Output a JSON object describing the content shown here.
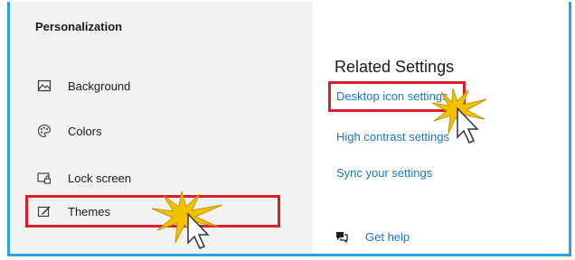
{
  "sidebar": {
    "title": "Personalization",
    "items": [
      {
        "label": "Background",
        "icon": "image-icon"
      },
      {
        "label": "Colors",
        "icon": "palette-icon"
      },
      {
        "label": "Lock screen",
        "icon": "lock-screen-icon"
      },
      {
        "label": "Themes",
        "icon": "themes-icon",
        "selected": true
      }
    ]
  },
  "main": {
    "section_title": "Related Settings",
    "links": [
      "Desktop icon settings",
      "High contrast settings",
      "Sync your settings"
    ],
    "help_label": "Get help"
  },
  "colors": {
    "accent": "#29a3e0",
    "highlight": "#d91f2a",
    "link": "#1a78c2",
    "sidebar_bg": "#f2f2f2",
    "click_burst": "#f2c200"
  }
}
